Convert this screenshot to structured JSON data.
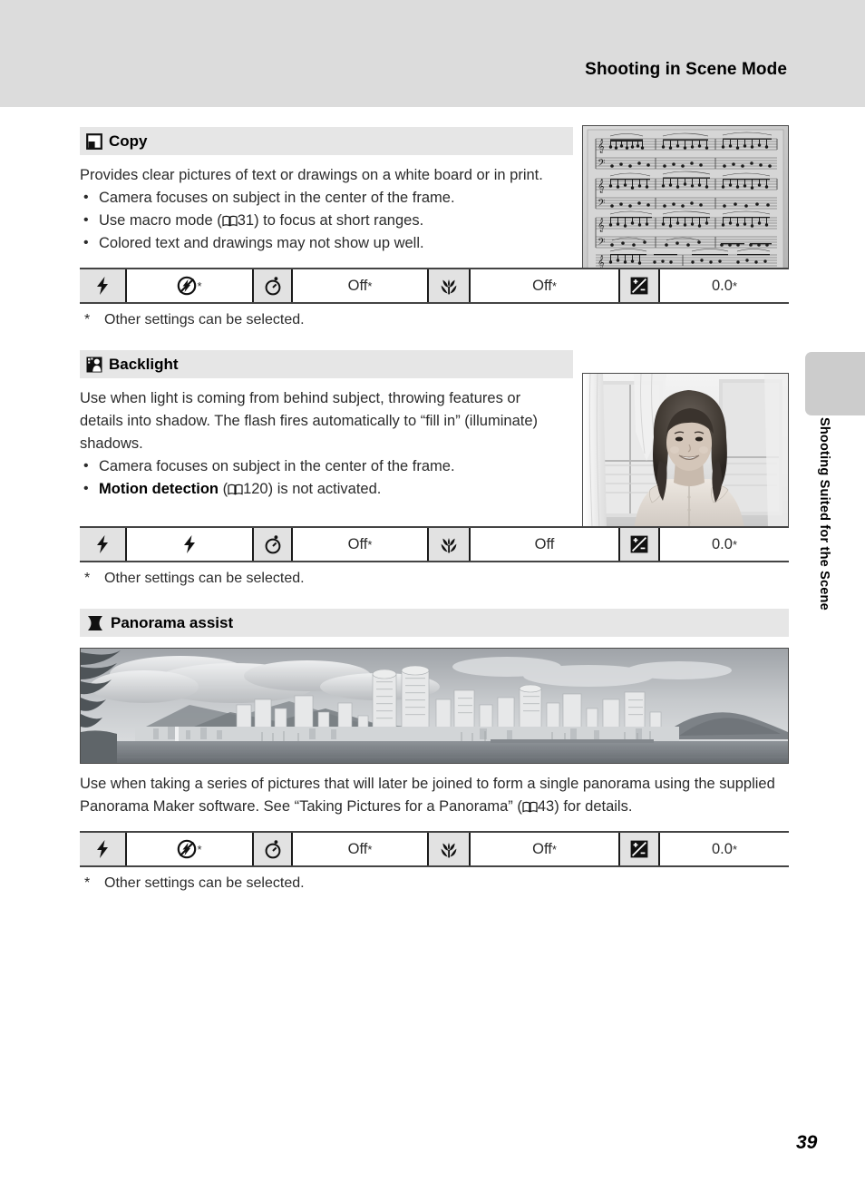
{
  "header": {
    "title": "Shooting in Scene Mode"
  },
  "side_tab": {
    "label": "Shooting Suited for the Scene"
  },
  "page": {
    "number": "39"
  },
  "sections": [
    {
      "id": "copy",
      "icon_name": "copy-scene-icon",
      "title": "Copy",
      "paragraph": "Provides clear pictures of text or drawings on a white board or in print.",
      "bullets": [
        {
          "pre": "Camera focuses on subject in the center of the frame.",
          "ref": "",
          "post": ""
        },
        {
          "pre": "Use macro mode (",
          "ref": "31",
          "post": ") to focus at short ranges."
        },
        {
          "pre": "Colored text and drawings may not show up well.",
          "ref": "",
          "post": ""
        }
      ],
      "photo": {
        "name": "sheet-music-photo",
        "alt": "Black and white photograph of printed sheet music"
      },
      "footnote": {
        "star": "*",
        "text": "Other settings can be selected."
      }
    },
    {
      "id": "backlight",
      "icon_name": "backlight-scene-icon",
      "title": "Backlight",
      "paragraph": "Use when light is coming from behind subject, throwing features or details into shadow. The flash fires automatically to “fill in” (illuminate) shadows.",
      "bullets": [
        {
          "pre": "Camera focuses on subject in the center of the frame.",
          "ref": "",
          "post": ""
        },
        {
          "bold": "Motion detection",
          "pre": " (",
          "ref": "120",
          "post": ") is not activated."
        }
      ],
      "photo": {
        "name": "backlit-portrait-photo",
        "alt": "Black and white backlit portrait of a smiling woman in front of a window"
      },
      "footnote": {
        "star": "*",
        "text": "Other settings can be selected."
      }
    },
    {
      "id": "panorama",
      "icon_name": "panorama-assist-icon",
      "title": "Panorama assist",
      "paragraph_pre": "Use when taking a series of pictures that will later be joined to form a single panorama using the supplied Panorama Maker software. See “Taking Pictures for a Panorama” (",
      "paragraph_ref": "43",
      "paragraph_post": ") for details.",
      "photo": {
        "name": "panorama-skyline-photo",
        "alt": "Black and white panoramic photograph of a city skyline with mountains and water"
      },
      "footnote": {
        "star": "*",
        "text": "Other settings can be selected."
      }
    }
  ],
  "settings_tables": [
    {
      "id": "copy-settings",
      "cells": [
        {
          "type": "icon",
          "name": "flash-mode-icon",
          "glyph": "flash"
        },
        {
          "type": "value",
          "name": "flash-mode-value",
          "glyph": "flash-off",
          "text": "",
          "star": "*"
        },
        {
          "type": "icon",
          "name": "self-timer-icon",
          "glyph": "self-timer"
        },
        {
          "type": "value",
          "name": "self-timer-value",
          "glyph": "",
          "text": "Off",
          "star": "*"
        },
        {
          "type": "icon",
          "name": "macro-mode-icon",
          "glyph": "macro"
        },
        {
          "type": "value",
          "name": "macro-mode-value",
          "glyph": "",
          "text": "Off",
          "star": "*"
        },
        {
          "type": "icon",
          "name": "exposure-compensation-icon",
          "glyph": "exposure"
        },
        {
          "type": "value",
          "name": "exposure-compensation-value",
          "glyph": "",
          "text": "0.0",
          "star": "*"
        }
      ]
    },
    {
      "id": "backlight-settings",
      "cells": [
        {
          "type": "icon",
          "name": "flash-mode-icon",
          "glyph": "flash"
        },
        {
          "type": "value",
          "name": "flash-mode-value",
          "glyph": "flash",
          "text": "",
          "star": ""
        },
        {
          "type": "icon",
          "name": "self-timer-icon",
          "glyph": "self-timer"
        },
        {
          "type": "value",
          "name": "self-timer-value",
          "glyph": "",
          "text": "Off",
          "star": "*"
        },
        {
          "type": "icon",
          "name": "macro-mode-icon",
          "glyph": "macro"
        },
        {
          "type": "value",
          "name": "macro-mode-value",
          "glyph": "",
          "text": "Off",
          "star": ""
        },
        {
          "type": "icon",
          "name": "exposure-compensation-icon",
          "glyph": "exposure"
        },
        {
          "type": "value",
          "name": "exposure-compensation-value",
          "glyph": "",
          "text": "0.0",
          "star": "*"
        }
      ]
    },
    {
      "id": "panorama-settings",
      "cells": [
        {
          "type": "icon",
          "name": "flash-mode-icon",
          "glyph": "flash"
        },
        {
          "type": "value",
          "name": "flash-mode-value",
          "glyph": "flash-off",
          "text": "",
          "star": "*"
        },
        {
          "type": "icon",
          "name": "self-timer-icon",
          "glyph": "self-timer"
        },
        {
          "type": "value",
          "name": "self-timer-value",
          "glyph": "",
          "text": "Off",
          "star": "*"
        },
        {
          "type": "icon",
          "name": "macro-mode-icon",
          "glyph": "macro"
        },
        {
          "type": "value",
          "name": "macro-mode-value",
          "glyph": "",
          "text": "Off",
          "star": "*"
        },
        {
          "type": "icon",
          "name": "exposure-compensation-icon",
          "glyph": "exposure"
        },
        {
          "type": "value",
          "name": "exposure-compensation-value",
          "glyph": "",
          "text": "0.0",
          "star": "*"
        }
      ]
    }
  ],
  "colors": {
    "header_band": "#dcdcdc",
    "section_bar": "#e6e6e6",
    "icon_cell": "#e2e2e2",
    "side_tab": "#cccccc",
    "text": "#2b2b2b"
  }
}
